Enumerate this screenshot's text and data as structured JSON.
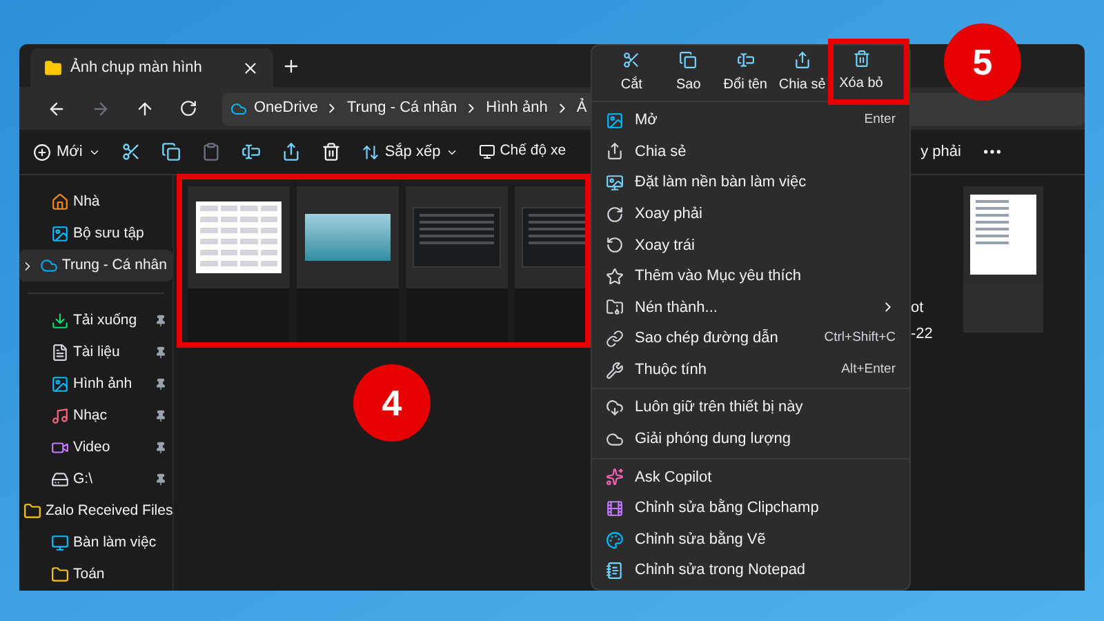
{
  "tab": {
    "title": "Ảnh chụp màn hình"
  },
  "address": {
    "crumbs": [
      "OneDrive",
      "Trung - Cá nhân",
      "Hình ảnh",
      "Ả"
    ]
  },
  "toolbar": {
    "new_label": "Mới",
    "sort_label": "Sắp xếp",
    "view_label": "Chế độ xe",
    "cut_label": "y phải"
  },
  "sidebar": {
    "items": [
      {
        "label": "Nhà",
        "selected": false,
        "pinned": false,
        "expandable": false
      },
      {
        "label": "Bộ sưu tập",
        "selected": false,
        "pinned": false,
        "expandable": false
      },
      {
        "label": "Trung - Cá nhân",
        "selected": true,
        "pinned": false,
        "expandable": true
      },
      {
        "label": "Tải xuống",
        "selected": false,
        "pinned": true,
        "expandable": false
      },
      {
        "label": "Tài liệu",
        "selected": false,
        "pinned": true,
        "expandable": false
      },
      {
        "label": "Hình ảnh",
        "selected": false,
        "pinned": true,
        "expandable": false
      },
      {
        "label": "Nhạc",
        "selected": false,
        "pinned": true,
        "expandable": false
      },
      {
        "label": "Video",
        "selected": false,
        "pinned": true,
        "expandable": false
      },
      {
        "label": "G:\\",
        "selected": false,
        "pinned": true,
        "expandable": false
      },
      {
        "label": "Zalo Received Files",
        "selected": false,
        "pinned": false,
        "expandable": false
      },
      {
        "label": "Bàn làm việc",
        "selected": false,
        "pinned": false,
        "expandable": false
      },
      {
        "label": "Toán",
        "selected": false,
        "pinned": false,
        "expandable": false
      }
    ]
  },
  "files": {
    "tiles": [
      {
        "kind": "table"
      },
      {
        "kind": "landscape"
      },
      {
        "kind": "dark"
      },
      {
        "kind": "dark"
      }
    ],
    "name_fragments": [
      "ot",
      "-22"
    ],
    "right_tile": {
      "kind": "document"
    }
  },
  "context_menu": {
    "actions": [
      {
        "label": "Cắt",
        "highlighted": false
      },
      {
        "label": "Sao",
        "highlighted": false
      },
      {
        "label": "Đổi tên",
        "highlighted": false
      },
      {
        "label": "Chia sẻ",
        "highlighted": false
      },
      {
        "label": "Xóa bỏ",
        "highlighted": true
      }
    ],
    "groups": [
      [
        {
          "label": "Mở",
          "shortcut": "Enter",
          "submenu": false
        },
        {
          "label": "Chia sẻ",
          "submenu": false
        },
        {
          "label": "Đặt làm nền bàn làm việc",
          "submenu": false
        },
        {
          "label": "Xoay phải",
          "submenu": false
        },
        {
          "label": "Xoay trái",
          "submenu": false
        },
        {
          "label": "Thêm vào Mục yêu thích",
          "submenu": false
        },
        {
          "label": "Nén thành...",
          "submenu": true
        },
        {
          "label": "Sao chép đường dẫn",
          "shortcut": "Ctrl+Shift+C",
          "submenu": false
        },
        {
          "label": "Thuộc tính",
          "shortcut": "Alt+Enter",
          "submenu": false
        }
      ],
      [
        {
          "label": "Luôn giữ trên thiết bị này",
          "submenu": false
        },
        {
          "label": "Giải phóng dung lượng",
          "submenu": false
        }
      ],
      [
        {
          "label": "Ask Copilot",
          "submenu": false
        },
        {
          "label": "Chỉnh sửa bằng Clipchamp",
          "submenu": false
        },
        {
          "label": "Chỉnh sửa bằng Vẽ",
          "submenu": false
        },
        {
          "label": "Chỉnh sửa trong Notepad",
          "submenu": false
        }
      ]
    ]
  },
  "annotations": [
    "4",
    "5"
  ]
}
